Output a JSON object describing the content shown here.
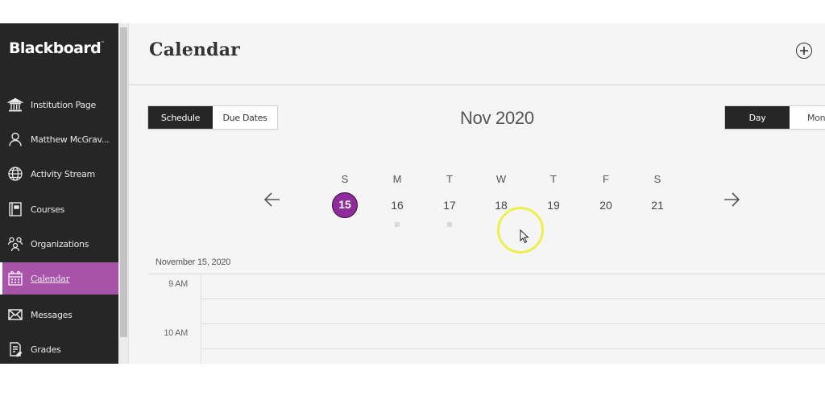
{
  "app": {
    "brand": "Blackboard",
    "brand_mark": "™"
  },
  "sidebar": {
    "items": [
      {
        "label": "Institution Page",
        "icon": "institution-icon",
        "active": false
      },
      {
        "label": "Matthew McGrav...",
        "icon": "user-icon",
        "active": false
      },
      {
        "label": "Activity Stream",
        "icon": "globe-icon",
        "active": false
      },
      {
        "label": "Courses",
        "icon": "courses-icon",
        "active": false
      },
      {
        "label": "Organizations",
        "icon": "organizations-icon",
        "active": false
      },
      {
        "label": "Calendar",
        "icon": "calendar-icon",
        "active": true
      },
      {
        "label": "Messages",
        "icon": "envelope-icon",
        "active": false
      },
      {
        "label": "Grades",
        "icon": "grades-icon",
        "active": false
      }
    ],
    "active_color": "#a653a8"
  },
  "header": {
    "title": "Calendar",
    "add_icon": "plus-circle-icon"
  },
  "view_toggle": {
    "options": [
      "Schedule",
      "Due Dates"
    ],
    "selected": "Schedule"
  },
  "range_toggle": {
    "options": [
      "Day",
      "Mon"
    ],
    "selected": "Day"
  },
  "month_label": "Nov 2020",
  "week": {
    "prev_icon": "arrow-left-icon",
    "next_icon": "arrow-right-icon",
    "days": [
      {
        "dow": "S",
        "num": "15",
        "selected": true,
        "has_items": false
      },
      {
        "dow": "M",
        "num": "16",
        "selected": false,
        "has_items": true
      },
      {
        "dow": "T",
        "num": "17",
        "selected": false,
        "has_items": true
      },
      {
        "dow": "W",
        "num": "18",
        "selected": false,
        "has_items": false
      },
      {
        "dow": "T",
        "num": "19",
        "selected": false,
        "has_items": false
      },
      {
        "dow": "F",
        "num": "20",
        "selected": false,
        "has_items": false
      },
      {
        "dow": "S",
        "num": "21",
        "selected": false,
        "has_items": false
      }
    ],
    "selected_color": "#8e2c9c"
  },
  "schedule": {
    "date_heading": "November 15, 2020",
    "time_labels": [
      "9 AM",
      "10 AM"
    ]
  }
}
